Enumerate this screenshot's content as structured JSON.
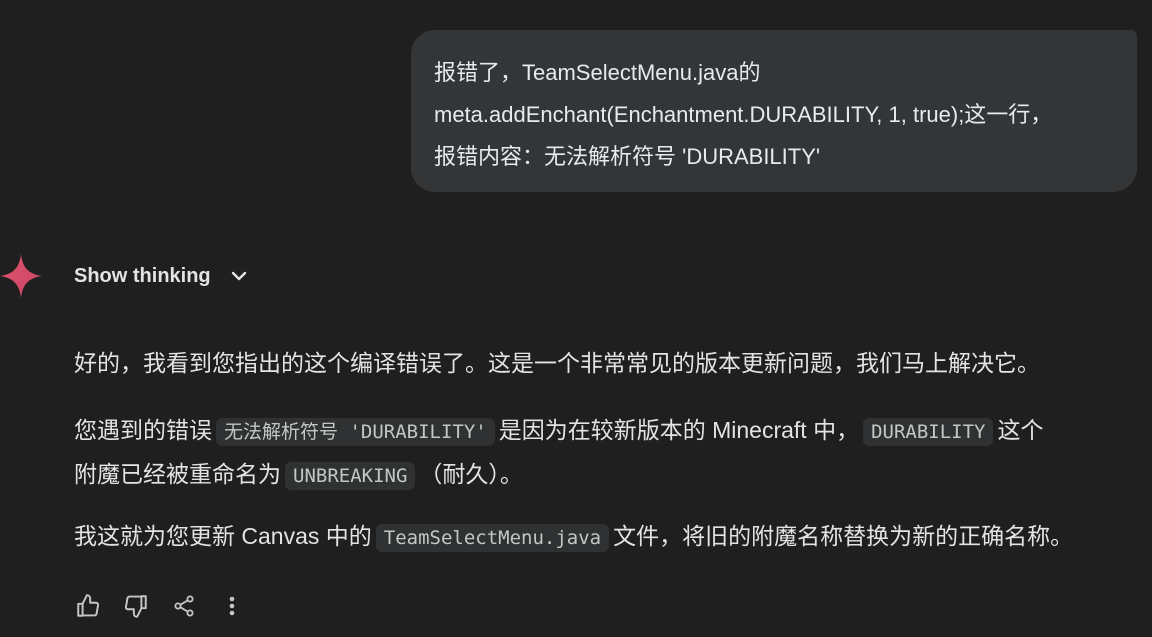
{
  "user_message": {
    "line1": "报错了，TeamSelectMenu.java的",
    "line2": "meta.addEnchant(Enchantment.DURABILITY, 1, true);这一行，",
    "line3": "报错内容：无法解析符号 'DURABILITY'"
  },
  "thinking": {
    "label": "Show thinking"
  },
  "response": {
    "p1": "好的，我看到您指出的这个编译错误了。这是一个非常常见的版本更新问题，我们马上解决它。",
    "p2_a": "您遇到的错误",
    "p2_code1": "无法解析符号 'DURABILITY'",
    "p2_b": "是因为在较新版本的 Minecraft 中，",
    "p2_code2": "DURABILITY",
    "p2_c": "这个",
    "p2_d": "附魔已经被重命名为",
    "p2_code3": "UNBREAKING",
    "p2_e": "（耐久）。",
    "p3_a": "我这就为您更新 Canvas 中的",
    "p3_code": "TeamSelectMenu.java",
    "p3_b": "文件，将旧的附魔名称替换为新的正确名称。"
  },
  "actions": {
    "icons": [
      "thumbs-up-icon",
      "thumbs-down-icon",
      "share-icon",
      "more-vert-icon"
    ]
  },
  "colors": {
    "background": "#1f1f1f",
    "bubble": "#333537",
    "code_bg": "#2f3133",
    "gem_start": "#4f7ee8",
    "gem_end": "#e0566b"
  }
}
